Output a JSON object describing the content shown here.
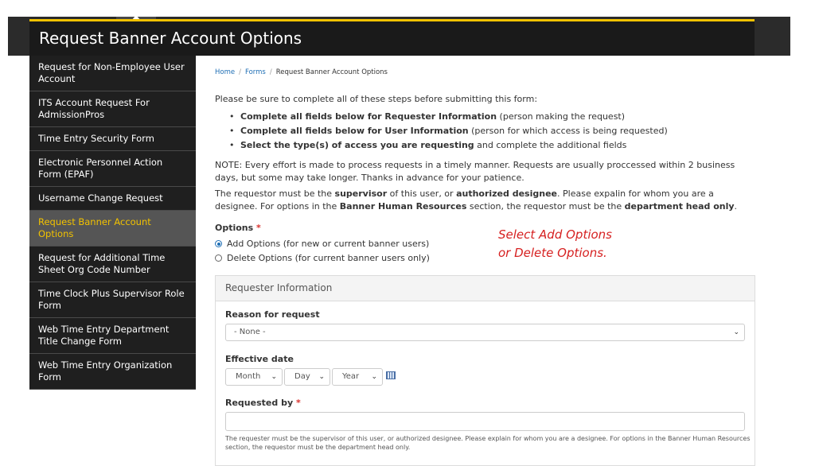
{
  "window": {
    "title": "Request Banner Account Options"
  },
  "sidebar": {
    "items": [
      {
        "label": "Request for Non-Employee User Account",
        "active": false
      },
      {
        "label": "ITS Account Request For AdmissionPros",
        "active": false
      },
      {
        "label": "Time Entry Security Form",
        "active": false
      },
      {
        "label": "Electronic Personnel Action Form (EPAF)",
        "active": false
      },
      {
        "label": "Username Change Request",
        "active": false
      },
      {
        "label": "Request Banner Account Options",
        "active": true
      },
      {
        "label": "Request for Additional Time Sheet Org Code Number",
        "active": false
      },
      {
        "label": "Time Clock Plus Supervisor Role Form",
        "active": false
      },
      {
        "label": "Web Time Entry Department Title Change Form",
        "active": false
      },
      {
        "label": "Web Time Entry Organization Form",
        "active": false
      }
    ]
  },
  "breadcrumb": {
    "home": "Home",
    "separator": "/",
    "forms": "Forms",
    "current": "Request Banner Account Options"
  },
  "intro": "Please be sure to complete all of these steps before submitting this form:",
  "steps": [
    {
      "bold": "Complete all fields below for Requester Information",
      "rest": " (person making the request)"
    },
    {
      "bold": "Complete all fields below for User Information",
      "rest": " (person for which access is being requested)"
    },
    {
      "bold": "Select the type(s) of access you are requesting",
      "rest": " and complete the additional fields"
    }
  ],
  "note": "NOTE: Every effort is made to process requests in a timely manner. Requests are usually proccessed within 2 business days, but some may take longer. Thanks in advance for your patience.",
  "requirement": {
    "p1": "The requestor must be the ",
    "b1": "supervisor",
    "p2": " of this user, or ",
    "b2": "authorized designee",
    "p3": ". Please expalin for whom you are a designee. For options in the ",
    "b3": "Banner Human Resources",
    "p4": " section, the requestor must be the ",
    "b4": "department head only",
    "p5": "."
  },
  "options": {
    "label": "Options",
    "required_mark": "*",
    "choices": [
      {
        "label": "Add Options (for new or current banner users)",
        "checked": true
      },
      {
        "label": "Delete Options (for current banner users only)",
        "checked": false
      }
    ]
  },
  "annotation": {
    "line1": "Select Add Options",
    "line2": "or Delete Options."
  },
  "requester_panel": {
    "heading": "Requester Information",
    "reason_label": "Reason for request",
    "reason_value": "- None -",
    "effective_label": "Effective date",
    "month": "Month",
    "day": "Day",
    "year": "Year",
    "requested_by_label": "Requested by",
    "required_mark": "*",
    "help": "The requester must be the supervisor of this user, or authorized designee. Please explain for whom you are a designee. For options in the Banner Human Resources section, the requestor must be the department head only."
  },
  "icons": {
    "dropdown": "chevron-down-icon",
    "calendar": "calendar-icon",
    "radio": "radio-icon"
  },
  "colors": {
    "title_bar": "#1a1a1a",
    "title_accent": "#f2c200",
    "active_item_text": "#f2c200",
    "link": "#1f6fb5",
    "required": "#d9302c",
    "annotation": "#d62020"
  }
}
